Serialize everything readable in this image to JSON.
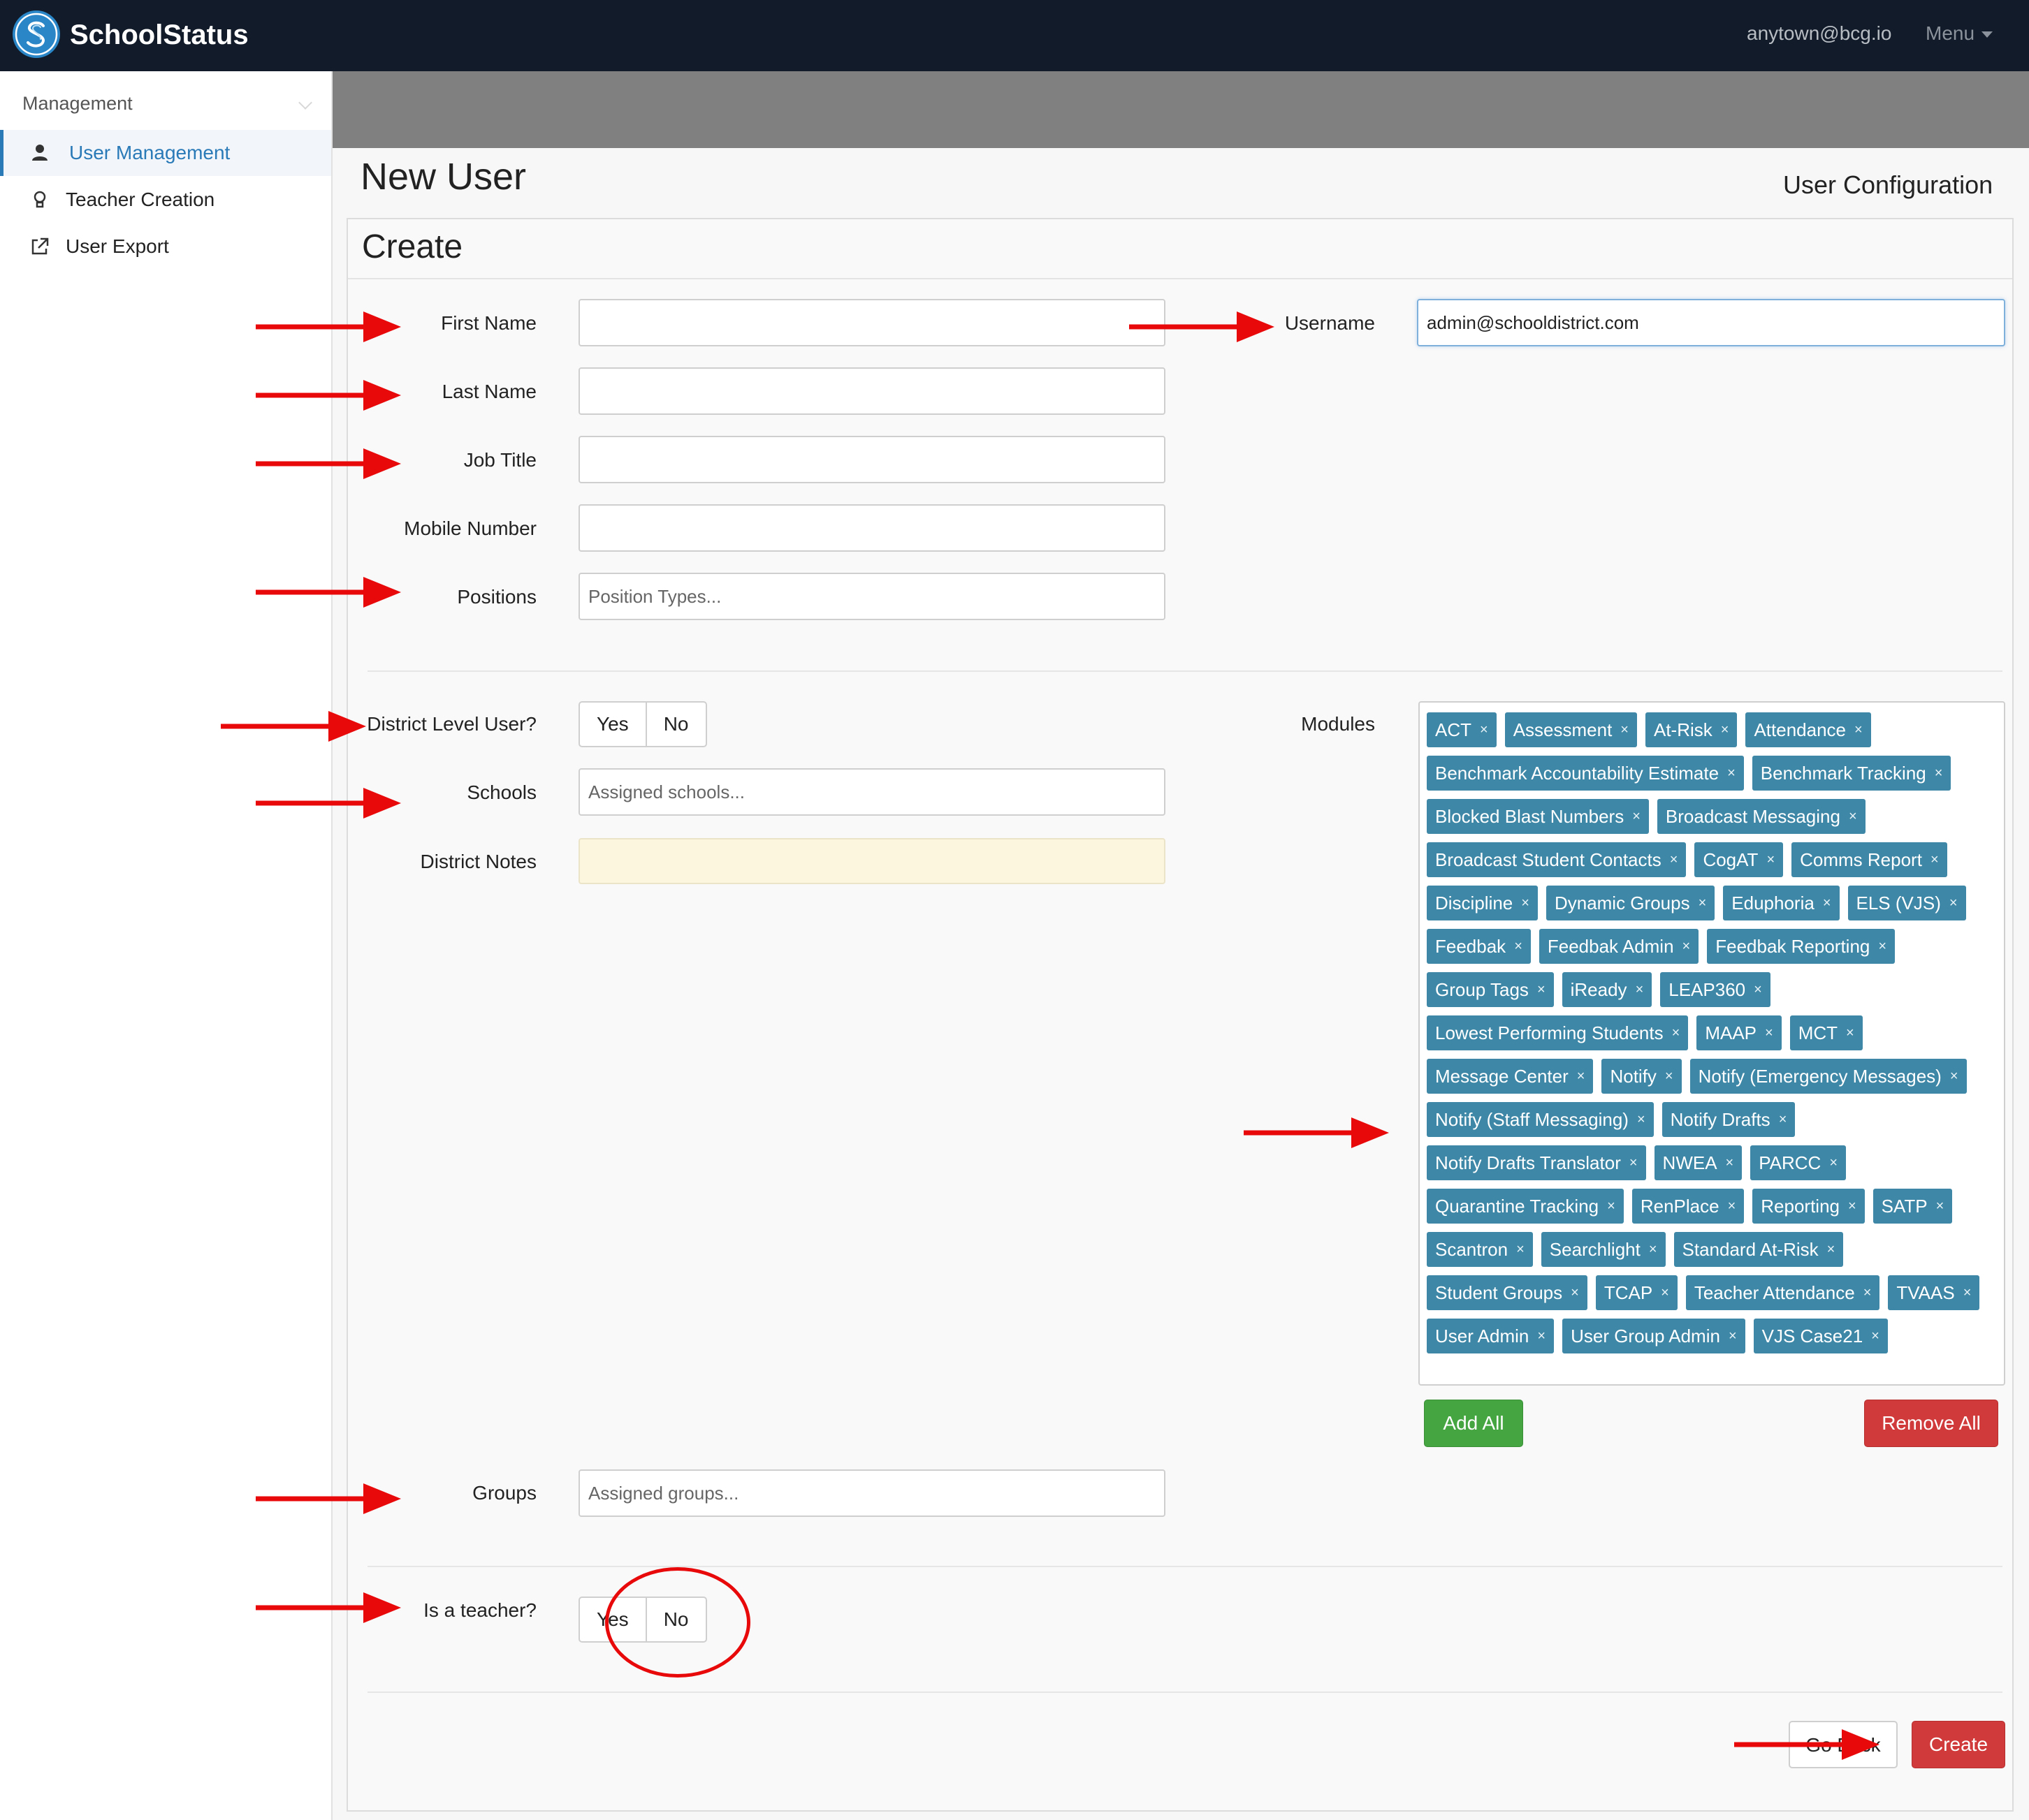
{
  "app": {
    "brand": "SchoolStatus",
    "user_email": "anytown@bcg.io",
    "menu_label": "Menu"
  },
  "sidebar": {
    "heading": "Management",
    "items": [
      {
        "label": "User Management",
        "icon": "user-icon",
        "active": true
      },
      {
        "label": "Teacher Creation",
        "icon": "lightbulb-icon",
        "active": false
      },
      {
        "label": "User Export",
        "icon": "external-link-icon",
        "active": false
      }
    ]
  },
  "page": {
    "title": "New User",
    "subtitle": "User Configuration",
    "card_title": "Create"
  },
  "form": {
    "first_name_label": "First Name",
    "first_name_value": "",
    "last_name_label": "Last Name",
    "last_name_value": "",
    "job_title_label": "Job Title",
    "job_title_value": "",
    "mobile_label": "Mobile Number",
    "mobile_value": "",
    "positions_label": "Positions",
    "positions_placeholder": "Position Types...",
    "username_label": "Username",
    "username_value": "admin@schooldistrict.com",
    "district_level_label": "District Level User?",
    "yes_label": "Yes",
    "no_label": "No",
    "schools_label": "Schools",
    "schools_placeholder": "Assigned schools...",
    "district_notes_label": "District Notes",
    "modules_label": "Modules",
    "groups_label": "Groups",
    "groups_placeholder": "Assigned groups...",
    "teacher_label": "Is a teacher?"
  },
  "modules": [
    "ACT",
    "Assessment",
    "At-Risk",
    "Attendance",
    "Benchmark Accountability Estimate",
    "Benchmark Tracking",
    "Blocked Blast Numbers",
    "Broadcast Messaging",
    "Broadcast Student Contacts",
    "CogAT",
    "Comms Report",
    "Discipline",
    "Dynamic Groups",
    "Eduphoria",
    "ELS (VJS)",
    "Feedbak",
    "Feedbak Admin",
    "Feedbak Reporting",
    "Group Tags",
    "iReady",
    "LEAP360",
    "Lowest Performing Students",
    "MAAP",
    "MCT",
    "Message Center",
    "Notify",
    "Notify (Emergency Messages)",
    "Notify (Staff Messaging)",
    "Notify Drafts",
    "Notify Drafts Translator",
    "NWEA",
    "PARCC",
    "Quarantine Tracking",
    "RenPlace",
    "Reporting",
    "SATP",
    "Scantron",
    "Searchlight",
    "Standard At-Risk",
    "Student Groups",
    "TCAP",
    "Teacher Attendance",
    "TVAAS",
    "User Admin",
    "User Group Admin",
    "VJS Case21"
  ],
  "module_remove_glyph": "×",
  "buttons": {
    "add_all": "Add All",
    "remove_all": "Remove All",
    "go_back": "Go Back",
    "create": "Create"
  },
  "colors": {
    "navbar": "#111b29",
    "accent_blue": "#2a7ab8",
    "tag": "#3e87a6",
    "success": "#45a541",
    "danger": "#d03a3a",
    "annotation_red": "#e8090b"
  }
}
